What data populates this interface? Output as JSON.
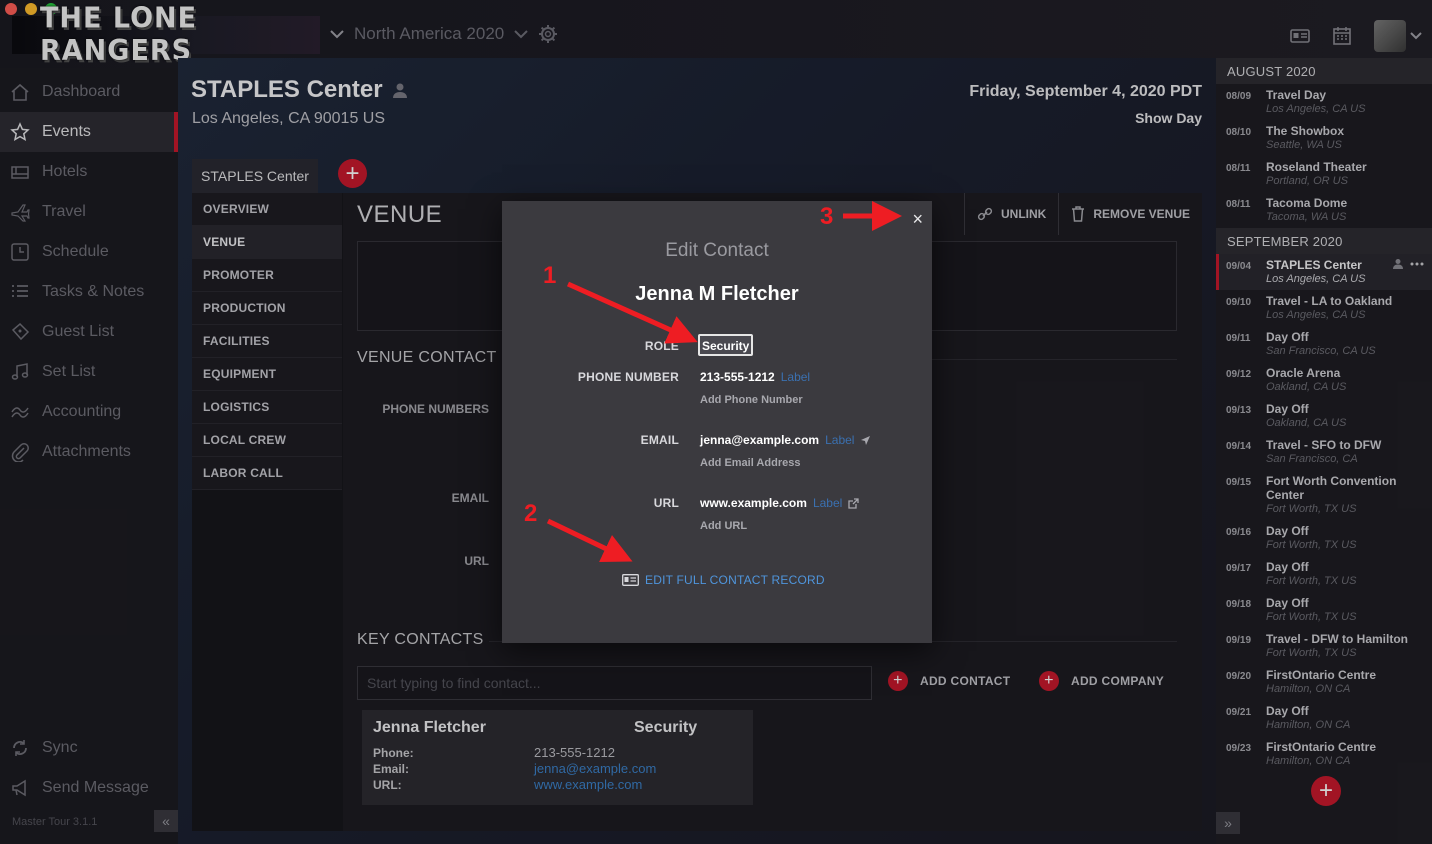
{
  "app": {
    "brand": "THE LONE RANGERS",
    "tour": "North America 2020",
    "version": "Master Tour 3.1.1"
  },
  "sidebar": {
    "items": [
      {
        "label": "Dashboard",
        "icon": "home-icon"
      },
      {
        "label": "Events",
        "icon": "star-icon"
      },
      {
        "label": "Hotels",
        "icon": "hotel-icon"
      },
      {
        "label": "Travel",
        "icon": "plane-icon"
      },
      {
        "label": "Schedule",
        "icon": "clock-icon"
      },
      {
        "label": "Tasks & Notes",
        "icon": "list-icon"
      },
      {
        "label": "Guest List",
        "icon": "ticket-icon"
      },
      {
        "label": "Set List",
        "icon": "music-note-icon"
      },
      {
        "label": "Accounting",
        "icon": "money-icon"
      },
      {
        "label": "Attachments",
        "icon": "paperclip-icon"
      }
    ],
    "active": "Events",
    "bottom": [
      {
        "label": "Sync",
        "icon": "sync-icon"
      },
      {
        "label": "Send Message",
        "icon": "megaphone-icon"
      }
    ]
  },
  "header": {
    "venue": "STAPLES Center",
    "address": "Los Angeles, CA 90015 US",
    "date": "Friday, September 4, 2020 PDT",
    "day_type": "Show Day",
    "venue_tab": "STAPLES Center"
  },
  "sections": [
    "OVERVIEW",
    "VENUE",
    "PROMOTER",
    "PRODUCTION",
    "FACILITIES",
    "EQUIPMENT",
    "LOGISTICS",
    "LOCAL CREW",
    "LABOR CALL"
  ],
  "active_section": "VENUE",
  "pane": {
    "title": "VENUE",
    "unlink": "UNLINK",
    "remove_venue": "REMOVE VENUE",
    "venue_contact_title": "VENUE CONTACT I",
    "labels": {
      "phone": "PHONE NUMBERS",
      "email": "EMAIL",
      "url": "URL"
    },
    "key_contacts_title": "KEY CONTACTS",
    "search_placeholder": "Start typing to find contact...",
    "add_contact": "ADD CONTACT",
    "add_company": "ADD COMPANY",
    "card": {
      "name": "Jenna Fletcher",
      "role": "Security",
      "phone_label": "Phone:",
      "email_label": "Email:",
      "url_label": "URL:",
      "phone": "213-555-1212",
      "email": "jenna@example.com",
      "url": "www.example.com"
    }
  },
  "timeline": {
    "months": [
      {
        "name": "AUGUST 2020",
        "events": [
          {
            "date": "08/09",
            "title": "Travel Day",
            "loc": "Los Angeles, CA US"
          },
          {
            "date": "08/10",
            "title": "The Showbox",
            "loc": "Seattle, WA US"
          },
          {
            "date": "08/11",
            "title": "Roseland Theater",
            "loc": "Portland, OR US"
          },
          {
            "date": "08/11",
            "title": "Tacoma Dome",
            "loc": "Tacoma, WA US"
          }
        ]
      },
      {
        "name": "SEPTEMBER 2020",
        "events": [
          {
            "date": "09/04",
            "title": "STAPLES Center",
            "loc": "Los Angeles, CA US",
            "selected": true
          },
          {
            "date": "09/10",
            "title": "Travel - LA to Oakland",
            "loc": "Los Angeles, CA US"
          },
          {
            "date": "09/11",
            "title": "Day Off",
            "loc": "San Francisco, CA US"
          },
          {
            "date": "09/12",
            "title": "Oracle Arena",
            "loc": "Oakland, CA US"
          },
          {
            "date": "09/13",
            "title": "Day Off",
            "loc": "Oakland, CA US"
          },
          {
            "date": "09/14",
            "title": "Travel - SFO to DFW",
            "loc": "San Francisco, CA"
          },
          {
            "date": "09/15",
            "title": "Fort Worth Convention Center",
            "loc": "Fort Worth, TX US"
          },
          {
            "date": "09/16",
            "title": "Day Off",
            "loc": "Fort Worth, TX US"
          },
          {
            "date": "09/17",
            "title": "Day Off",
            "loc": "Fort Worth, TX US"
          },
          {
            "date": "09/18",
            "title": "Day Off",
            "loc": "Fort Worth, TX US"
          },
          {
            "date": "09/19",
            "title": "Travel - DFW to Hamilton",
            "loc": "Fort Worth, TX US"
          },
          {
            "date": "09/20",
            "title": "FirstOntario Centre",
            "loc": "Hamilton, ON CA"
          },
          {
            "date": "09/21",
            "title": "Day Off",
            "loc": "Hamilton, ON CA"
          },
          {
            "date": "09/23",
            "title": "FirstOntario Centre",
            "loc": "Hamilton, ON CA"
          }
        ]
      }
    ]
  },
  "modal": {
    "title": "Edit Contact",
    "name": "Jenna M Fletcher",
    "role_label": "ROLE",
    "role_value": "Security",
    "phone_label": "PHONE NUMBER",
    "phone_value": "213-555-1212",
    "email_label": "EMAIL",
    "email_value": "jenna@example.com",
    "url_label": "URL",
    "url_value": "www.example.com",
    "label_tag": "Label",
    "add_phone": "Add Phone Number",
    "add_email": "Add Email Address",
    "add_url": "Add URL",
    "full_record": "EDIT FULL CONTACT RECORD",
    "close": "×"
  },
  "annotations": [
    "1",
    "2",
    "3"
  ],
  "colors": {
    "accent": "#c6192d",
    "link": "#4f95dc",
    "annotation": "#ee1d23"
  }
}
